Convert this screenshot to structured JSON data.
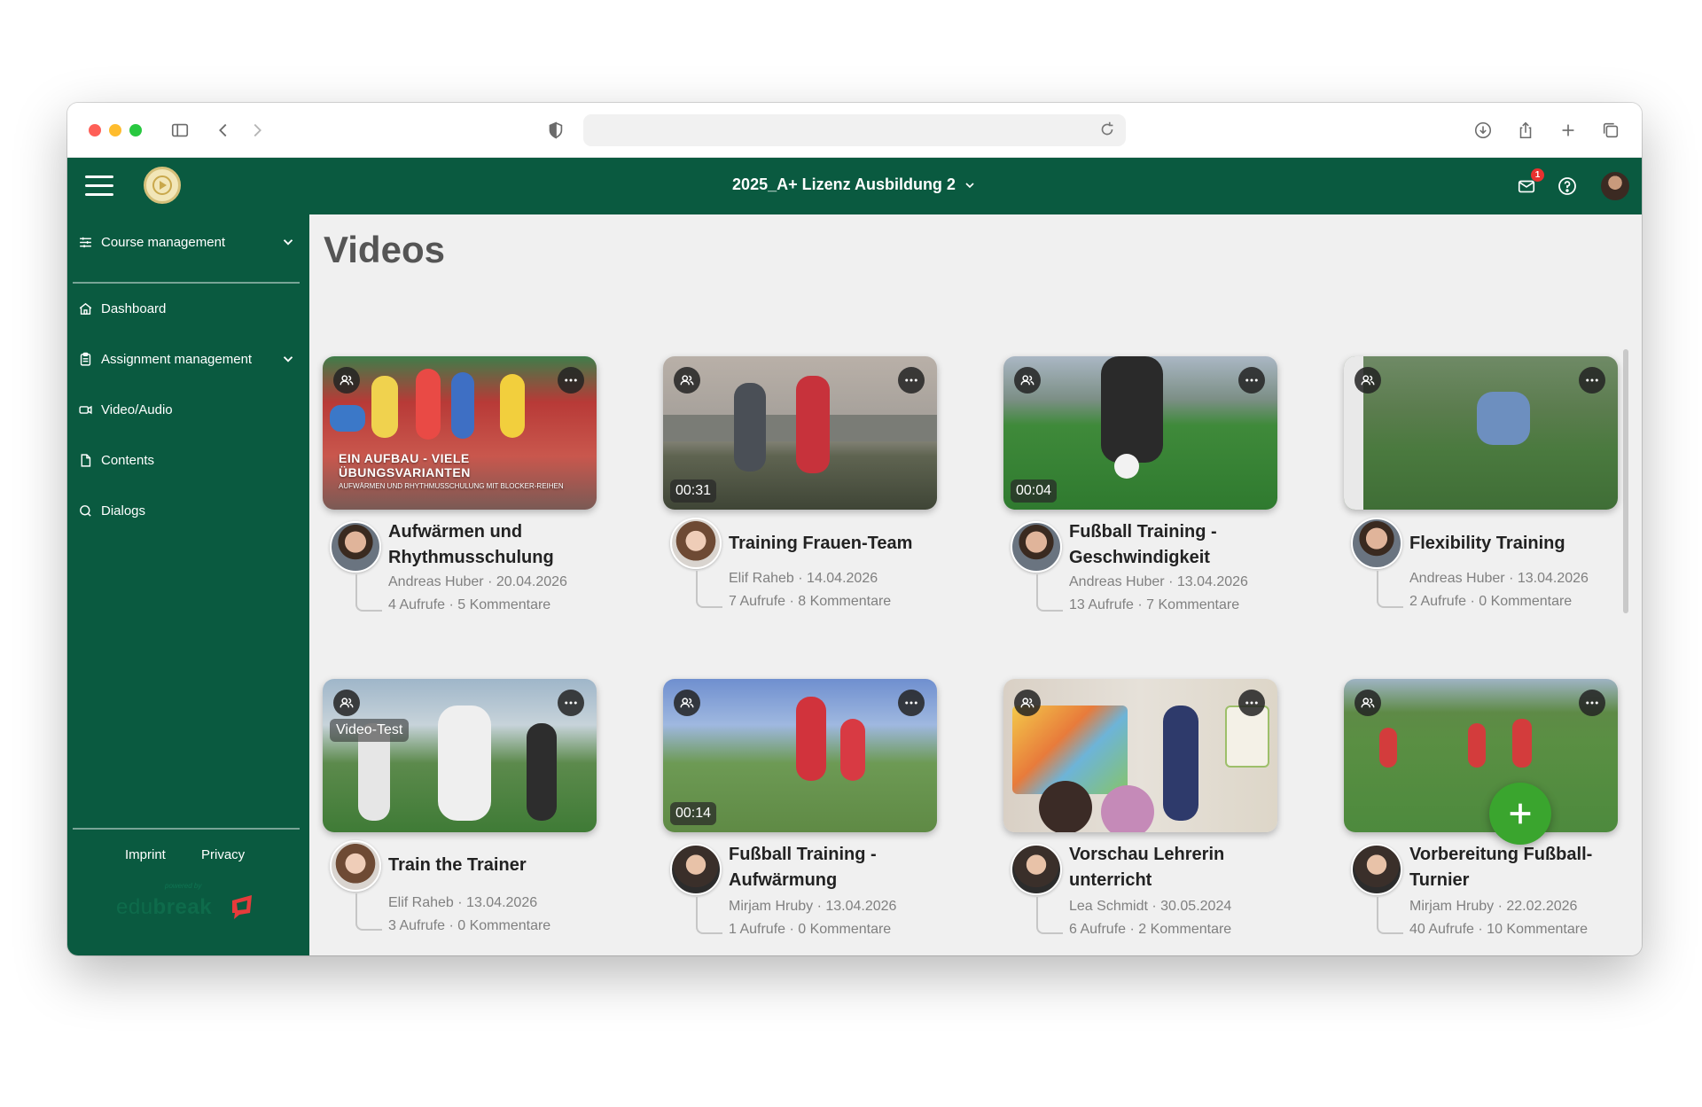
{
  "browser": {
    "url": ""
  },
  "topbar": {
    "course": "2025_A+ Lizenz Ausbildung 2",
    "mail_badge": "1"
  },
  "sidebar": {
    "course_management": "Course management",
    "items": [
      {
        "label": "Dashboard",
        "icon": "home-icon"
      },
      {
        "label": "Assignment management",
        "icon": "clipboard-icon"
      },
      {
        "label": "Video/Audio",
        "icon": "video-camera-icon"
      },
      {
        "label": "Contents",
        "icon": "document-icon"
      },
      {
        "label": "Dialogs",
        "icon": "chat-icon"
      }
    ],
    "footer": {
      "imprint": "Imprint",
      "privacy": "Privacy",
      "powered": "powered by",
      "brand_light": "edu",
      "brand_bold": "break"
    }
  },
  "main": {
    "title": "Videos",
    "videos": [
      {
        "title": "Aufwärmen und Rhythmusschulung",
        "author": "Andreas Huber · 20.04.2026",
        "stats": "4 Aufrufe · 5 Kommentare",
        "duration": "",
        "caption": "EIN AUFBAU - VIELE ÜBUNGSVARIANTEN",
        "caption_sub": "AUFWÄRMEN UND RHYTHMUSSCHULUNG MIT BLOCKER-REIHEN"
      },
      {
        "title": "Training Frauen-Team",
        "author": "Elif Raheb · 14.04.2026",
        "stats": "7 Aufrufe · 8 Kommentare",
        "duration": "00:31"
      },
      {
        "title": "Fußball Training - Geschwindigkeit",
        "author": "Andreas Huber · 13.04.2026",
        "stats": "13 Aufrufe · 7 Kommentare",
        "duration": "00:04"
      },
      {
        "title": "Flexibility Training",
        "author": "Andreas Huber · 13.04.2026",
        "stats": "2 Aufrufe · 0 Kommentare",
        "duration": ""
      },
      {
        "title": "Train the Trainer",
        "author": "Elif Raheb · 13.04.2026",
        "stats": "3 Aufrufe · 0 Kommentare",
        "duration": "",
        "tag": "Video-Test"
      },
      {
        "title": "Fußball Training - Aufwärmung",
        "author": "Mirjam Hruby · 13.04.2026",
        "stats": "1 Aufrufe · 0 Kommentare",
        "duration": "00:14"
      },
      {
        "title": "Vorschau Lehrerin unterricht",
        "author": "Lea Schmidt · 30.05.2024",
        "stats": "6 Aufrufe · 2 Kommentare",
        "duration": ""
      },
      {
        "title": "Vorbereitung Fußball-Turnier",
        "author": "Mirjam Hruby · 22.02.2026",
        "stats": "40 Aufrufe · 10 Kommentare",
        "duration": ""
      }
    ]
  },
  "colors": {
    "brand_green": "#0a5a40",
    "fab_green": "#3aa52e",
    "badge_red": "#e8312f"
  }
}
